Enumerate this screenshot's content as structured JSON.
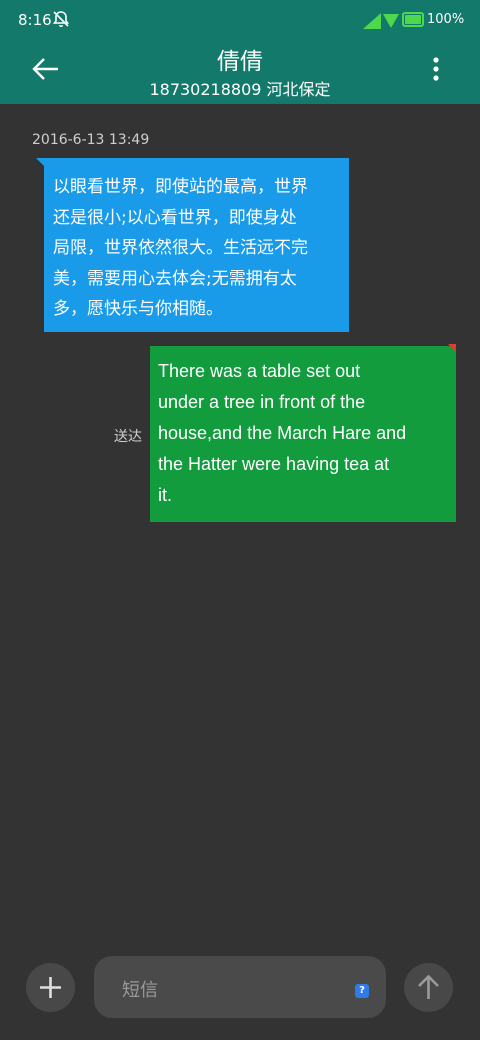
{
  "status_bar": {
    "time": "8:16",
    "battery_percent_text": "100%",
    "battery_level": 1.0,
    "icons": [
      "bell-muted-icon",
      "signal-icon",
      "wifi-icon",
      "battery-icon"
    ]
  },
  "header": {
    "contact_name": "倩倩",
    "contact_detail": "18730218809 河北保定",
    "back_icon": "arrow-left-icon",
    "menu_icon": "more-vertical-icon",
    "color": "#137a6b"
  },
  "conversation": {
    "timestamp": "2016-6-13 13:49",
    "messages": [
      {
        "direction": "incoming",
        "lines": [
          "以眼看世界，即使站的最高，世界",
          "还是很小;以心看世界，即使身处",
          "局限，世界依然很大。生活远不完",
          "美，需要用心去体会;无需拥有太",
          "多，愿快乐与你相随。"
        ],
        "color": "#1a9bea"
      },
      {
        "direction": "outgoing",
        "lines": [
          "There was a table set out",
          "under a tree in front of the",
          "house,and the March Hare and",
          "the Hatter were having tea at",
          "it."
        ],
        "status": "送达",
        "color": "#129c3e"
      }
    ]
  },
  "composer": {
    "placeholder": "短信",
    "help_icon_text": "?",
    "add_icon": "plus-icon",
    "send_icon": "arrow-up-icon"
  }
}
